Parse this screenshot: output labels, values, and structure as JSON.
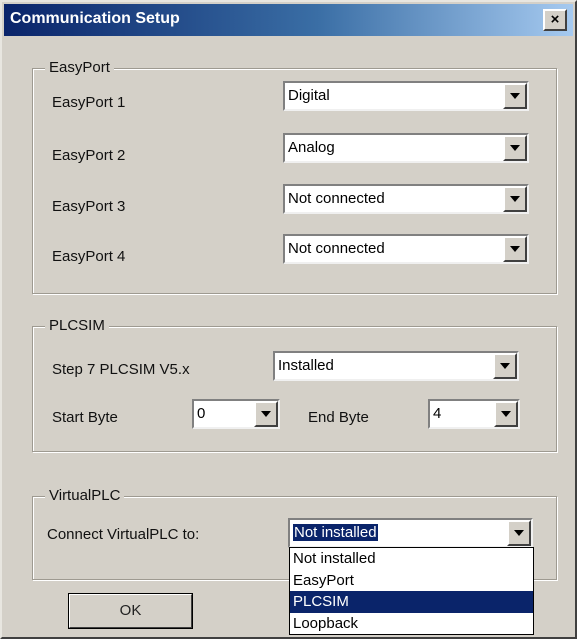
{
  "window": {
    "title": "Communication Setup",
    "close_label": "×"
  },
  "easyport": {
    "legend": "EasyPort",
    "rows": [
      {
        "label": "EasyPort 1",
        "value": "Digital"
      },
      {
        "label": "EasyPort 2",
        "value": "Analog"
      },
      {
        "label": "EasyPort 3",
        "value": "Not connected"
      },
      {
        "label": "EasyPort 4",
        "value": "Not connected"
      }
    ]
  },
  "plcsim": {
    "legend": "PLCSIM",
    "step7_label": "Step 7 PLCSIM V5.x",
    "step7_value": "Installed",
    "start_byte_label": "Start Byte",
    "start_byte_value": "0",
    "end_byte_label": "End Byte",
    "end_byte_value": "4"
  },
  "virtualplc": {
    "legend": "VirtualPLC",
    "connect_label": "Connect VirtualPLC to:",
    "connect_value": "Not installed",
    "options": [
      "Not installed",
      "EasyPort",
      "PLCSIM",
      "Loopback"
    ],
    "highlighted_option": "PLCSIM"
  },
  "buttons": {
    "ok_label": "OK"
  }
}
